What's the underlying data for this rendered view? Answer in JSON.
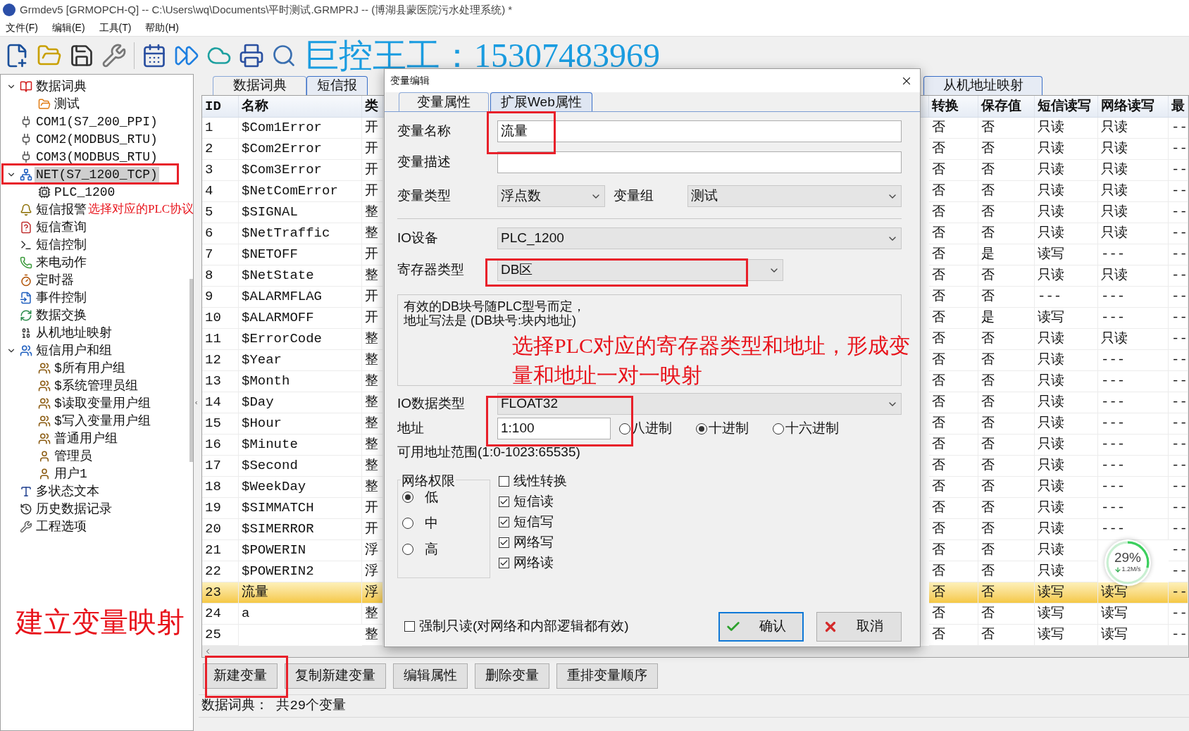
{
  "window": {
    "title": "Grmdev5 [GRMOPCH-Q]  -- C:\\Users\\wq\\Documents\\平时测试.GRMPRJ -- (博湖县蒙医院污水处理系统) *"
  },
  "menu": [
    "文件(F)",
    "编辑(E)",
    "工具(T)",
    "帮助(H)"
  ],
  "tree": [
    {
      "label": "数据词典",
      "kind": "book",
      "selected": false,
      "expanded": true,
      "children": [
        {
          "label": "测试",
          "kind": "folder",
          "selected": false
        }
      ]
    },
    {
      "label": "COM1(S7_200_PPI)",
      "kind": "port",
      "selected": false
    },
    {
      "label": "COM2(MODBUS_RTU)",
      "kind": "port",
      "selected": false
    },
    {
      "label": "COM3(MODBUS_RTU)",
      "kind": "port",
      "selected": false
    },
    {
      "label": "NET(S7_1200_TCP)",
      "kind": "network",
      "selected": true,
      "expanded": true,
      "children": [
        {
          "label": "PLC_1200",
          "kind": "plc",
          "selected": false
        }
      ]
    },
    {
      "label": "短信报警",
      "kind": "bell",
      "selected": false
    },
    {
      "label": "短信查询",
      "kind": "query",
      "selected": false
    },
    {
      "label": "短信控制",
      "kind": "cmd",
      "selected": false
    },
    {
      "label": "来电动作",
      "kind": "phone",
      "selected": false
    },
    {
      "label": "定时器",
      "kind": "timer",
      "selected": false
    },
    {
      "label": "事件控制",
      "kind": "event",
      "selected": false
    },
    {
      "label": "数据交换",
      "kind": "exchange",
      "selected": false
    },
    {
      "label": "从机地址映射",
      "kind": "binary",
      "selected": false
    },
    {
      "label": "短信用户和组",
      "kind": "users",
      "selected": false,
      "expanded": true,
      "children": [
        {
          "label": "$所有用户组",
          "kind": "group",
          "selected": false
        },
        {
          "label": "$系统管理员组",
          "kind": "group",
          "selected": false
        },
        {
          "label": "$读取变量用户组",
          "kind": "group",
          "selected": false
        },
        {
          "label": "$写入变量用户组",
          "kind": "group",
          "selected": false
        },
        {
          "label": "普通用户组",
          "kind": "group",
          "selected": false
        },
        {
          "label": "管理员",
          "kind": "user",
          "selected": false
        },
        {
          "label": "用户1",
          "kind": "user",
          "selected": false
        }
      ]
    },
    {
      "label": "多状态文本",
      "kind": "text",
      "selected": false
    },
    {
      "label": "历史数据记录",
      "kind": "history",
      "selected": false
    },
    {
      "label": "工程选项",
      "kind": "wrench",
      "selected": false
    }
  ],
  "tabs": [
    {
      "label": "数据词典",
      "selected": true
    },
    {
      "label": "短信报",
      "selected": false
    },
    {
      "label": "从机地址映射",
      "selected": false
    }
  ],
  "table": {
    "columns": [
      "ID",
      "名称",
      "类",
      "转换",
      "保存值",
      "短信读写",
      "网络读写",
      "最"
    ],
    "rows": [
      {
        "id": "1",
        "name": "$Com1Error",
        "type": "开",
        "convert": "否",
        "save": "否",
        "sms": "只读",
        "net": "只读",
        "last": "--",
        "selected": false
      },
      {
        "id": "2",
        "name": "$Com2Error",
        "type": "开",
        "convert": "否",
        "save": "否",
        "sms": "只读",
        "net": "只读",
        "last": "--",
        "selected": false
      },
      {
        "id": "3",
        "name": "$Com3Error",
        "type": "开",
        "convert": "否",
        "save": "否",
        "sms": "只读",
        "net": "只读",
        "last": "--",
        "selected": false
      },
      {
        "id": "4",
        "name": "$NetComError",
        "type": "开",
        "convert": "否",
        "save": "否",
        "sms": "只读",
        "net": "只读",
        "last": "--",
        "selected": false
      },
      {
        "id": "5",
        "name": "$SIGNAL",
        "type": "整",
        "convert": "否",
        "save": "否",
        "sms": "只读",
        "net": "只读",
        "last": "--",
        "selected": false
      },
      {
        "id": "6",
        "name": "$NetTraffic",
        "type": "整",
        "convert": "否",
        "save": "否",
        "sms": "只读",
        "net": "只读",
        "last": "--",
        "selected": false
      },
      {
        "id": "7",
        "name": "$NETOFF",
        "type": "开",
        "convert": "否",
        "save": "是",
        "sms": "读写",
        "net": "---",
        "last": "--",
        "selected": false
      },
      {
        "id": "8",
        "name": "$NetState",
        "type": "整",
        "convert": "否",
        "save": "否",
        "sms": "只读",
        "net": "只读",
        "last": "--",
        "selected": false
      },
      {
        "id": "9",
        "name": "$ALARMFLAG",
        "type": "开",
        "convert": "否",
        "save": "否",
        "sms": "---",
        "net": "---",
        "last": "--",
        "selected": false
      },
      {
        "id": "10",
        "name": "$ALARMOFF",
        "type": "开",
        "convert": "否",
        "save": "是",
        "sms": "读写",
        "net": "---",
        "last": "--",
        "selected": false
      },
      {
        "id": "11",
        "name": "$ErrorCode",
        "type": "整",
        "convert": "否",
        "save": "否",
        "sms": "只读",
        "net": "只读",
        "last": "--",
        "selected": false
      },
      {
        "id": "12",
        "name": "$Year",
        "type": "整",
        "convert": "否",
        "save": "否",
        "sms": "只读",
        "net": "---",
        "last": "--",
        "selected": false
      },
      {
        "id": "13",
        "name": "$Month",
        "type": "整",
        "convert": "否",
        "save": "否",
        "sms": "只读",
        "net": "---",
        "last": "--",
        "selected": false
      },
      {
        "id": "14",
        "name": "$Day",
        "type": "整",
        "convert": "否",
        "save": "否",
        "sms": "只读",
        "net": "---",
        "last": "--",
        "selected": false
      },
      {
        "id": "15",
        "name": "$Hour",
        "type": "整",
        "convert": "否",
        "save": "否",
        "sms": "只读",
        "net": "---",
        "last": "--",
        "selected": false
      },
      {
        "id": "16",
        "name": "$Minute",
        "type": "整",
        "convert": "否",
        "save": "否",
        "sms": "只读",
        "net": "---",
        "last": "--",
        "selected": false
      },
      {
        "id": "17",
        "name": "$Second",
        "type": "整",
        "convert": "否",
        "save": "否",
        "sms": "只读",
        "net": "---",
        "last": "--",
        "selected": false
      },
      {
        "id": "18",
        "name": "$WeekDay",
        "type": "整",
        "convert": "否",
        "save": "否",
        "sms": "只读",
        "net": "---",
        "last": "--",
        "selected": false
      },
      {
        "id": "19",
        "name": "$SIMMATCH",
        "type": "开",
        "convert": "否",
        "save": "否",
        "sms": "只读",
        "net": "---",
        "last": "--",
        "selected": false
      },
      {
        "id": "20",
        "name": "$SIMERROR",
        "type": "开",
        "convert": "否",
        "save": "否",
        "sms": "只读",
        "net": "---",
        "last": "--",
        "selected": false
      },
      {
        "id": "21",
        "name": "$POWERIN",
        "type": "浮",
        "convert": "否",
        "save": "否",
        "sms": "只读",
        "last": "--",
        "selected": false
      },
      {
        "id": "22",
        "name": "$POWERIN2",
        "type": "浮",
        "convert": "否",
        "save": "否",
        "sms": "只读",
        "last": "--",
        "selected": false
      },
      {
        "id": "23",
        "name": "流量",
        "type": "浮",
        "convert": "否",
        "save": "否",
        "sms": "读写",
        "net": "读写",
        "last": "--",
        "selected": true
      },
      {
        "id": "24",
        "name": "a",
        "type": "整",
        "convert": "否",
        "save": "否",
        "sms": "读写",
        "net": "读写",
        "last": "--",
        "selected": false
      },
      {
        "id": "25",
        "type": "整",
        "convert": "否",
        "save": "否",
        "sms": "读写",
        "net": "读写",
        "last": "--",
        "selected": false
      }
    ]
  },
  "actions": [
    "新建变量",
    "复制新建变量",
    "编辑属性",
    "删除变量",
    "重排变量顺序"
  ],
  "status_bar": "数据词典： 共29个变量",
  "dialog": {
    "title": "变量编辑",
    "tabs": [
      {
        "label": "变量属性",
        "selected": true
      },
      {
        "label": "扩展Web属性",
        "selected": false
      }
    ],
    "name": {
      "label": "变量名称",
      "value": "流量"
    },
    "description": {
      "label": "变量描述"
    },
    "var_type": {
      "label": "变量类型",
      "value": "浮点数"
    },
    "var_group": {
      "label": "变量组",
      "value": "测试"
    },
    "io_device": {
      "label": "IO设备",
      "value": "PLC_1200"
    },
    "register_type": {
      "label": "寄存器类型",
      "value": "DB区"
    },
    "hint_lines": [
      "有效的DB块号随PLC型号而定，",
      "地址写法是 (DB块号:块内地址)"
    ],
    "io_data_type": {
      "label": "IO数据类型",
      "value": "FLOAT32"
    },
    "address": {
      "label": "地址",
      "value": "1:100"
    },
    "radix": [
      {
        "label": "八进制",
        "selected": false
      },
      {
        "label": "十进制",
        "selected": true
      },
      {
        "label": "十六进制",
        "selected": false
      }
    ],
    "range": "可用地址范围(1:0-1023:65535)",
    "permission": {
      "title": "网络权限",
      "options": [
        {
          "label": "低",
          "selected": true
        },
        {
          "label": "中",
          "selected": false
        },
        {
          "label": "高",
          "selected": false
        }
      ]
    },
    "options": [
      {
        "label": "线性转换",
        "checked": false
      },
      {
        "label": "短信读",
        "checked": true
      },
      {
        "label": "短信写",
        "checked": true
      },
      {
        "label": "网络写",
        "checked": true
      },
      {
        "label": "网络读",
        "checked": true
      }
    ],
    "force_readonly": {
      "label": "强制只读(对网络和内部逻辑都有效)",
      "checked": false
    },
    "buttons": [
      {
        "label": "确认",
        "kind": "confirm"
      },
      {
        "label": "取消",
        "kind": "cancel"
      }
    ]
  },
  "speed_widget": {
    "percent": "29%",
    "speed": "1.2M/s",
    "level": 0.29
  },
  "annotations": {
    "contact": "巨控王工：15307483969",
    "protocol_note": "选择对应的PLC协议",
    "register_note_lines": [
      "选择PLC对应的寄存器类型和地址，形成变",
      "量和地址一对一映射"
    ],
    "mapping_note": "建立变量映射"
  }
}
